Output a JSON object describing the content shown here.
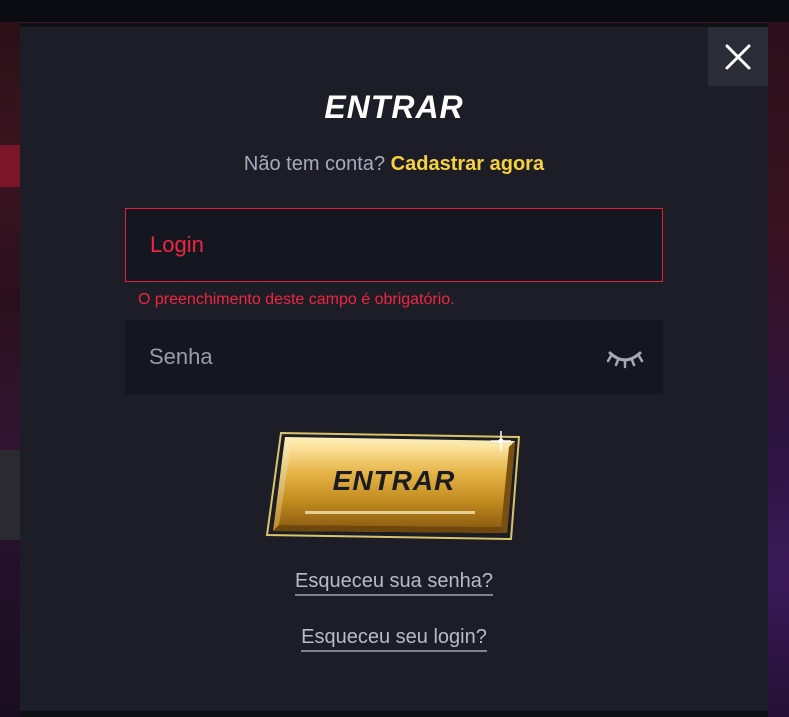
{
  "modal": {
    "title": "ENTRAR",
    "signup_prompt": "Não tem conta?",
    "signup_link": "Cadastrar agora",
    "close_icon": "close-icon"
  },
  "form": {
    "login": {
      "placeholder": "Login",
      "value": "",
      "error": "O preenchimento deste campo é obrigatório."
    },
    "password": {
      "placeholder": "Senha",
      "value": "",
      "toggle_icon": "eye-closed-icon"
    },
    "submit_label": "ENTRAR"
  },
  "links": {
    "forgot_password": "Esqueceu sua senha?",
    "forgot_login": "Esqueceu seu login?"
  },
  "colors": {
    "modal_bg": "#1c1d26",
    "field_bg": "#141720",
    "error": "#f0263f",
    "accent": "#f7d23e",
    "button_gold": "#d9a62e"
  }
}
